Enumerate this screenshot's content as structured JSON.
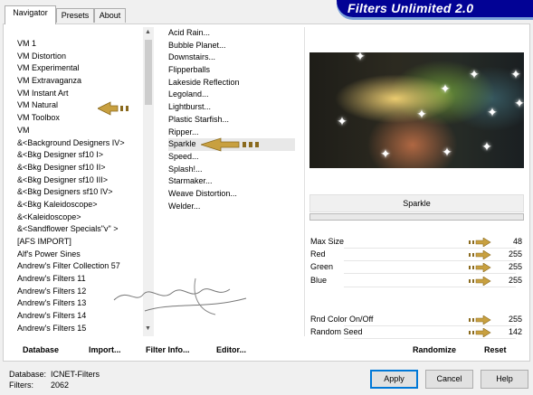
{
  "tabs": [
    "Navigator",
    "Presets",
    "About"
  ],
  "banner_title": "Filters Unlimited 2.0",
  "categories": [
    "VM 1",
    "VM Distortion",
    "VM Experimental",
    "VM Extravaganza",
    "VM Instant Art",
    "VM Natural",
    "VM Toolbox",
    "VM",
    "&<Background Designers IV>",
    "&<Bkg Designer sf10 I>",
    "&<Bkg Designer sf10 II>",
    "&<Bkg Designer sf10 III>",
    "&<Bkg Designers sf10 IV>",
    "&<Bkg Kaleidoscope>",
    "&<Kaleidoscope>",
    "&<Sandflower Specials\"v\" >",
    "[AFS IMPORT]",
    "Alf's Power Sines",
    "Andrew's Filter Collection 57",
    "Andrew's Filters 11",
    "Andrew's Filters 12",
    "Andrew's Filters 13",
    "Andrew's Filters 14",
    "Andrew's Filters 15"
  ],
  "filters": [
    "Acid Rain...",
    "Bubble Planet...",
    "Downstairs...",
    "Flipperballs",
    "Lakeside Reflection",
    "Legoland...",
    "Lightburst...",
    "Plastic Starfish...",
    "Ripper...",
    "Sparkle",
    "Speed...",
    "Splash!...",
    "Starmaker...",
    "Weave Distortion...",
    "Welder..."
  ],
  "selected_filter_name": "Sparkle",
  "params": [
    {
      "label": "Max Size",
      "value": "48"
    },
    {
      "label": "Red",
      "value": "255"
    },
    {
      "label": "Green",
      "value": "255"
    },
    {
      "label": "Blue",
      "value": "255"
    }
  ],
  "params2": [
    {
      "label": "Rnd Color On/Off",
      "value": "255"
    },
    {
      "label": "Random Seed",
      "value": "142"
    }
  ],
  "bottom_links": {
    "database": "Database",
    "import": "Import...",
    "filter_info": "Filter Info...",
    "editor": "Editor...",
    "randomize": "Randomize",
    "reset": "Reset"
  },
  "status": {
    "database_label": "Database:",
    "database_value": "ICNET-Filters",
    "filters_label": "Filters:",
    "filters_value": "2062"
  },
  "buttons": {
    "apply": "Apply",
    "cancel": "Cancel",
    "help": "Help"
  },
  "colors": {
    "banner": "#020295",
    "arrow": "#c8a040"
  }
}
